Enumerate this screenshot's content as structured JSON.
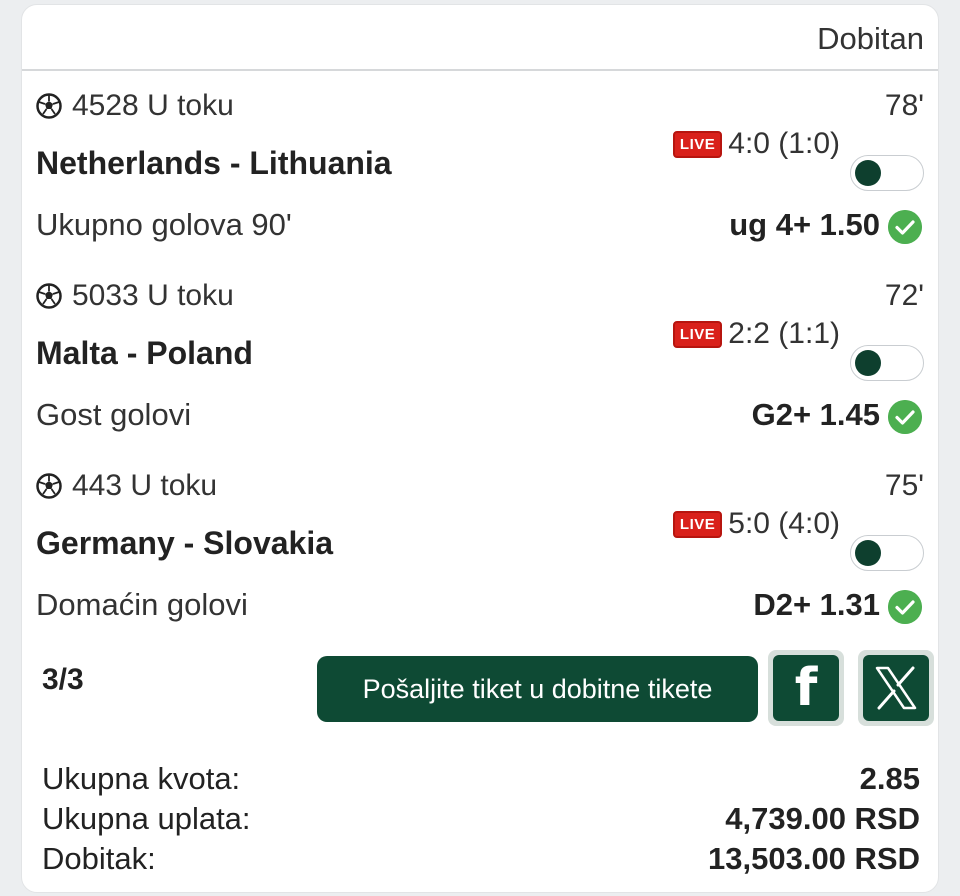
{
  "header": {
    "status": "Dobitan"
  },
  "matches": [
    {
      "code": "4528",
      "state": "U toku",
      "minute": "78'",
      "live": "LIVE",
      "teams": "Netherlands - Lithuania",
      "score": "4:0 (1:0)",
      "market": "Ukupno golova 90'",
      "pick": "ug 4+ 1.50"
    },
    {
      "code": "5033",
      "state": "U toku",
      "minute": "72'",
      "live": "LIVE",
      "teams": "Malta - Poland",
      "score": "2:2 (1:1)",
      "market": "Gost golovi",
      "pick": "G2+ 1.45"
    },
    {
      "code": "443",
      "state": "U toku",
      "minute": "75'",
      "live": "LIVE",
      "teams": "Germany - Slovakia",
      "score": "5:0 (4:0)",
      "market": "Domaćin golovi",
      "pick": "D2+ 1.31"
    }
  ],
  "ticket": {
    "count": "3/3",
    "send_label": "Pošaljite tiket u dobitne tikete",
    "facebook_icon": "f"
  },
  "totals": {
    "odds_label": "Ukupna kvota:",
    "odds_value": "2.85",
    "stake_label": "Ukupna uplata:",
    "stake_value": "4,739.00 RSD",
    "win_label": "Dobitak:",
    "win_value": "13,503.00 RSD"
  },
  "colors": {
    "brand": "#0e4a34",
    "live": "#d9211b",
    "success": "#4caf50"
  }
}
